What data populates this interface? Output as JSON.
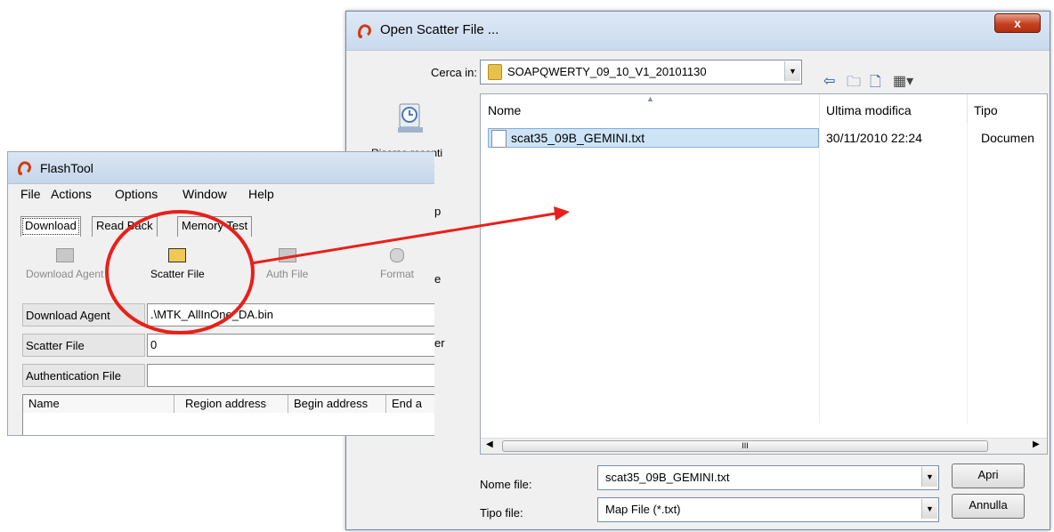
{
  "dialog": {
    "title": "Open Scatter File ...",
    "close_label": "x",
    "look_in_label": "Cerca in:",
    "look_in_value": "SOAPQWERTY_09_10_V1_20101130",
    "toolbar_icons": [
      "back-icon",
      "up-folder-icon",
      "new-folder-icon",
      "view-menu-icon"
    ],
    "places": [
      {
        "label": "Risorse recenti",
        "icon": "recent-places-icon"
      }
    ],
    "columns": [
      "Nome",
      "Ultima modifica",
      "Tipo"
    ],
    "files": [
      {
        "name": "scat35_09B_GEMINI.txt",
        "modified": "30/11/2010 22:24",
        "type": "Documen"
      }
    ],
    "scroll_thumb_grip": "III",
    "filename_label": "Nome file:",
    "filename_value": "scat35_09B_GEMINI.txt",
    "filetype_label": "Tipo file:",
    "filetype_value": "Map File (*.txt)",
    "open_button": "Apri",
    "cancel_button": "Annulla"
  },
  "flashtool": {
    "title": "FlashTool",
    "menu": [
      "File",
      "Actions",
      "Options",
      "Window",
      "Help"
    ],
    "tabs": [
      "Download",
      "Read Back",
      "Memory Test"
    ],
    "toolbar": [
      "Download Agent",
      "Scatter File",
      "Auth File",
      "Format"
    ],
    "fields": [
      {
        "label": "Download Agent",
        "value": ".\\MTK_AllInOne_DA.bin"
      },
      {
        "label": "Scatter File",
        "value": "0"
      },
      {
        "label": "Authentication File",
        "value": ""
      }
    ],
    "table_columns": [
      "Name",
      "Region address",
      "Begin address",
      "End a"
    ],
    "cut_off_text": [
      "p",
      "e",
      "er"
    ]
  },
  "annotation": {
    "circle_color": "#e8201a",
    "arrow_color": "#e8201a"
  }
}
